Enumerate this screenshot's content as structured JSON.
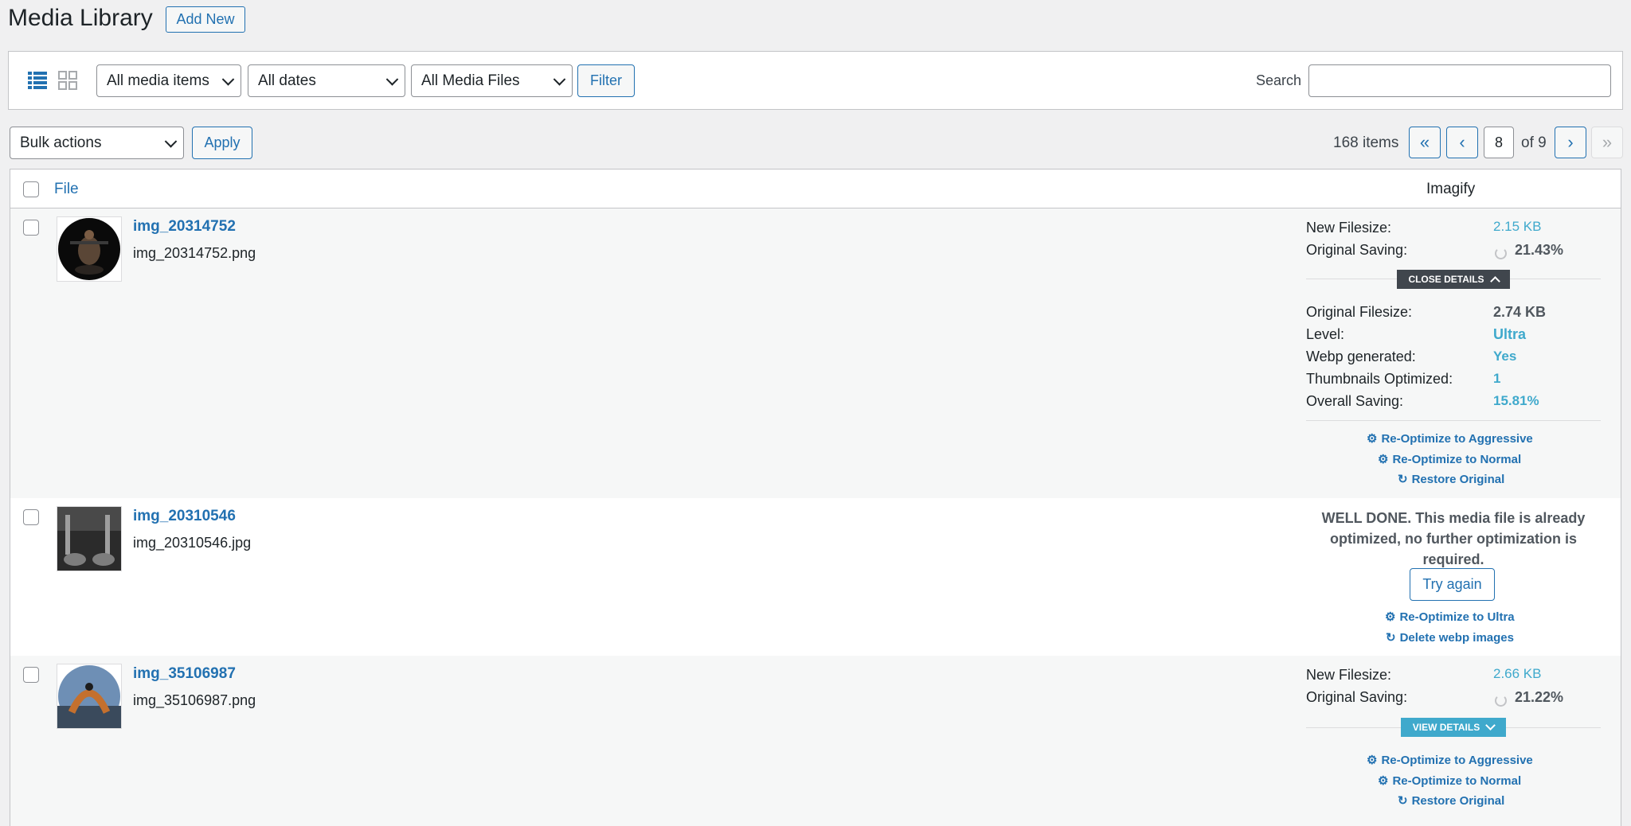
{
  "header": {
    "title": "Media Library",
    "add_new": "Add New"
  },
  "filters": {
    "media_type": "All media items",
    "dates": "All dates",
    "files": "All Media Files",
    "filter_button": "Filter",
    "search_label": "Search",
    "search_value": ""
  },
  "toolbar": {
    "bulk_actions": "Bulk actions",
    "apply": "Apply"
  },
  "pagination": {
    "items": "168 items",
    "first": "«",
    "prev": "‹",
    "current_page": "8",
    "of_total": "of 9",
    "next": "›",
    "last": "»"
  },
  "table": {
    "col_file": "File",
    "col_imagify": "Imagify",
    "rows": [
      {
        "title": "img_20314752",
        "filename": "img_20314752.png",
        "new_filesize_label": "New Filesize:",
        "new_filesize": "2.15 KB",
        "original_saving_label": "Original Saving:",
        "original_saving": "21.43%",
        "details_toggle": "CLOSE DETAILS",
        "details": {
          "original_filesize_label": "Original Filesize:",
          "original_filesize": "2.74 KB",
          "level_label": "Level:",
          "level": "Ultra",
          "webp_label": "Webp generated:",
          "webp": "Yes",
          "thumbs_label": "Thumbnails Optimized:",
          "thumbs": "1",
          "overall_label": "Overall Saving:",
          "overall": "15.81%"
        },
        "actions": [
          "Re-Optimize to Aggressive",
          "Re-Optimize to Normal",
          "Restore Original"
        ]
      },
      {
        "title": "img_20310546",
        "filename": "img_20310546.jpg",
        "message_line1": "WELL DONE. This media file is already",
        "message_line2": "optimized, no further optimization is",
        "message_line3": "required.",
        "try_again": "Try again",
        "actions": [
          "Re-Optimize to Ultra",
          "Delete webp images"
        ]
      },
      {
        "title": "img_35106987",
        "filename": "img_35106987.png",
        "new_filesize_label": "New Filesize:",
        "new_filesize": "2.66 KB",
        "original_saving_label": "Original Saving:",
        "original_saving": "21.22%",
        "details_toggle": "VIEW DETAILS",
        "actions": [
          "Re-Optimize to Aggressive",
          "Re-Optimize to Normal",
          "Restore Original"
        ]
      }
    ]
  },
  "colors": {
    "link": "#2271b1",
    "imagify_value": "#3fa9cc",
    "close_details_bg": "#40464d",
    "view_details_bg": "#3fa9cc"
  }
}
